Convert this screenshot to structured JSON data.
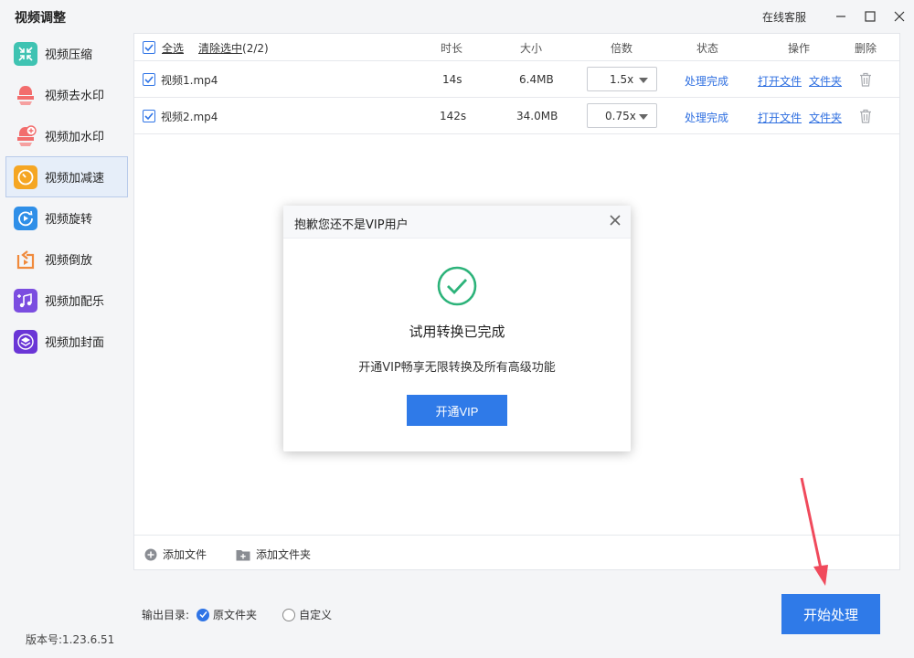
{
  "app": {
    "title": "视频调整",
    "service": "在线客服"
  },
  "sidebar": {
    "items": [
      {
        "label": "视频压缩",
        "icon": "compress-icon",
        "color": "#3fc3b2"
      },
      {
        "label": "视频去水印",
        "icon": "remove-watermark-icon",
        "color": "#f26d6d"
      },
      {
        "label": "视频加水印",
        "icon": "add-watermark-icon",
        "color": "#f26d6d"
      },
      {
        "label": "视频加减速",
        "icon": "speed-icon",
        "color": "#f5a623"
      },
      {
        "label": "视频旋转",
        "icon": "rotate-icon",
        "color": "#2f8fe8"
      },
      {
        "label": "视频倒放",
        "icon": "reverse-icon",
        "color": "#f08a3c"
      },
      {
        "label": "视频加配乐",
        "icon": "music-icon",
        "color": "#7b4de0"
      },
      {
        "label": "视频加封面",
        "icon": "cover-icon",
        "color": "#6a35d6"
      }
    ],
    "active_index": 3,
    "version": "版本号:1.23.6.51"
  },
  "table": {
    "select_all": "全选",
    "clear_selected": "清除选中",
    "selected_count": "(2/2)",
    "headers": {
      "duration": "时长",
      "size": "大小",
      "speed": "倍数",
      "status": "状态",
      "action": "操作",
      "delete": "删除"
    },
    "rows": [
      {
        "name": "视频1.mp4",
        "duration": "14s",
        "size": "6.4MB",
        "speed": "1.5x",
        "status": "处理完成",
        "open_file": "打开文件",
        "open_folder": "文件夹"
      },
      {
        "name": "视频2.mp4",
        "duration": "142s",
        "size": "34.0MB",
        "speed": "0.75x",
        "status": "处理完成",
        "open_file": "打开文件",
        "open_folder": "文件夹"
      }
    ],
    "add_file": "添加文件",
    "add_folder": "添加文件夹"
  },
  "output": {
    "label": "输出目录:",
    "option_original": "原文件夹",
    "option_custom": "自定义",
    "selected": "original"
  },
  "start_button": "开始处理",
  "modal": {
    "title": "抱歉您还不是VIP用户",
    "message": "试用转换已完成",
    "sub": "开通VIP畅享无限转换及所有高级功能",
    "button": "开通VIP"
  },
  "colors": {
    "accent": "#2f7ae8",
    "success": "#2db37a",
    "arrow": "#f04a5c"
  }
}
